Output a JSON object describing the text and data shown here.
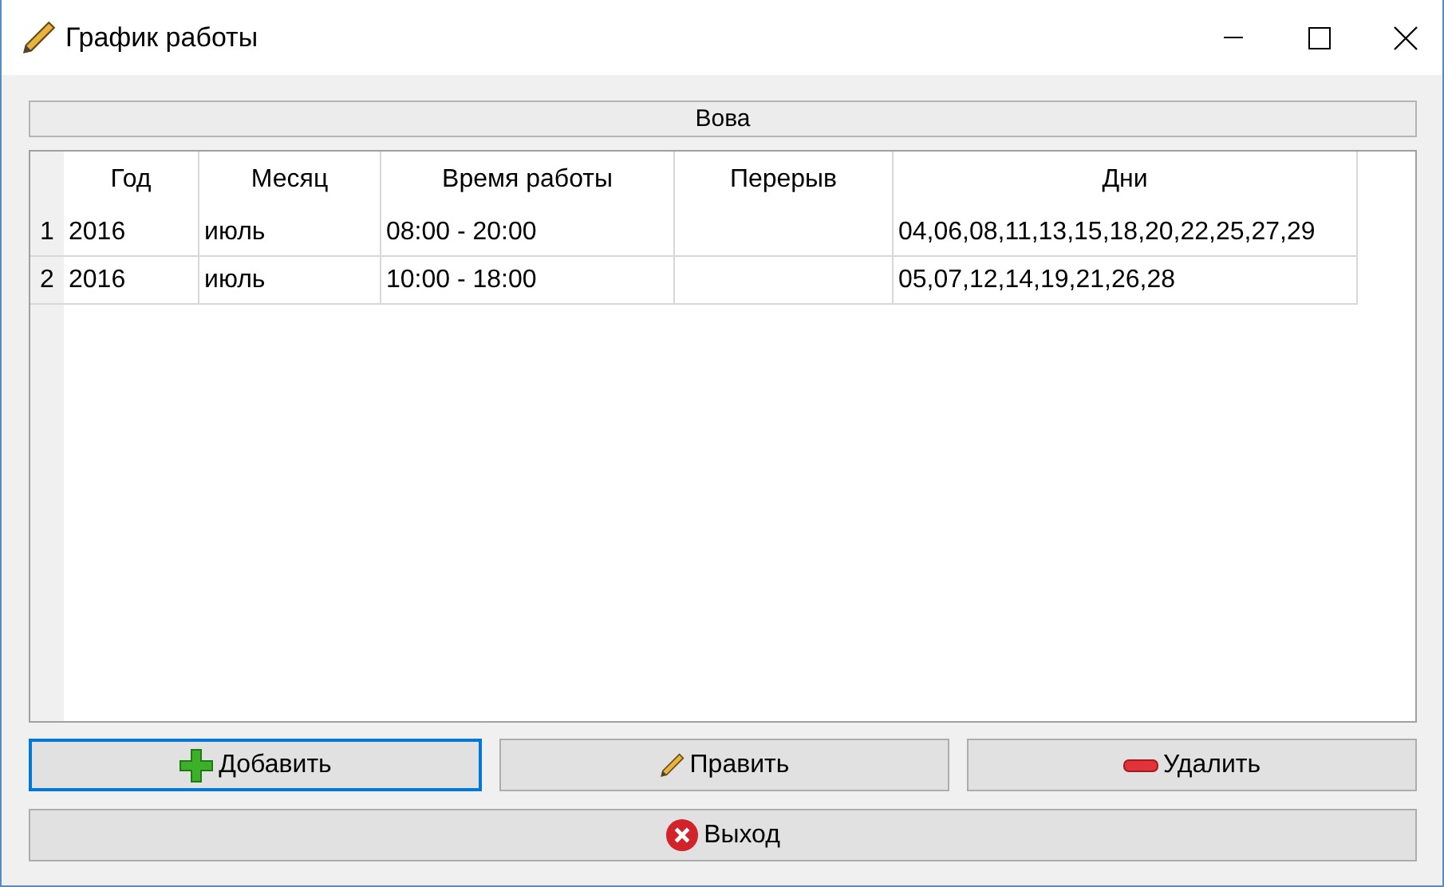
{
  "window": {
    "title": "График работы"
  },
  "header_label": "Вова",
  "table": {
    "columns": [
      "Год",
      "Месяц",
      "Время работы",
      "Перерыв",
      "Дни"
    ],
    "rows": [
      {
        "number": "1",
        "cells": [
          "2016",
          "июль",
          "08:00 - 20:00",
          "",
          "04,06,08,11,13,15,18,20,22,25,27,29"
        ]
      },
      {
        "number": "2",
        "cells": [
          "2016",
          "июль",
          "10:00 - 18:00",
          "",
          "05,07,12,14,19,21,26,28"
        ]
      }
    ]
  },
  "buttons": [
    {
      "label": "Добавить",
      "kind": "add",
      "focused": true
    },
    {
      "label": "Править",
      "kind": "edit",
      "focused": false
    },
    {
      "label": "Удалить",
      "kind": "delete",
      "focused": false
    }
  ],
  "exit_button": {
    "label": "Выход",
    "kind": "exit",
    "focused": false
  }
}
